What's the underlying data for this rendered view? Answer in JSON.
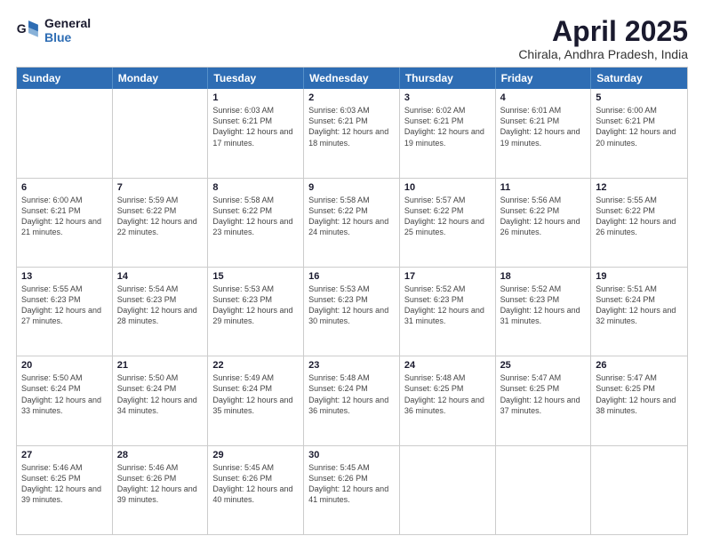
{
  "logo": {
    "line1": "General",
    "line2": "Blue"
  },
  "title": "April 2025",
  "subtitle": "Chirala, Andhra Pradesh, India",
  "days": [
    "Sunday",
    "Monday",
    "Tuesday",
    "Wednesday",
    "Thursday",
    "Friday",
    "Saturday"
  ],
  "weeks": [
    [
      {
        "day": "",
        "info": ""
      },
      {
        "day": "",
        "info": ""
      },
      {
        "day": "1",
        "info": "Sunrise: 6:03 AM\nSunset: 6:21 PM\nDaylight: 12 hours and 17 minutes."
      },
      {
        "day": "2",
        "info": "Sunrise: 6:03 AM\nSunset: 6:21 PM\nDaylight: 12 hours and 18 minutes."
      },
      {
        "day": "3",
        "info": "Sunrise: 6:02 AM\nSunset: 6:21 PM\nDaylight: 12 hours and 19 minutes."
      },
      {
        "day": "4",
        "info": "Sunrise: 6:01 AM\nSunset: 6:21 PM\nDaylight: 12 hours and 19 minutes."
      },
      {
        "day": "5",
        "info": "Sunrise: 6:00 AM\nSunset: 6:21 PM\nDaylight: 12 hours and 20 minutes."
      }
    ],
    [
      {
        "day": "6",
        "info": "Sunrise: 6:00 AM\nSunset: 6:21 PM\nDaylight: 12 hours and 21 minutes."
      },
      {
        "day": "7",
        "info": "Sunrise: 5:59 AM\nSunset: 6:22 PM\nDaylight: 12 hours and 22 minutes."
      },
      {
        "day": "8",
        "info": "Sunrise: 5:58 AM\nSunset: 6:22 PM\nDaylight: 12 hours and 23 minutes."
      },
      {
        "day": "9",
        "info": "Sunrise: 5:58 AM\nSunset: 6:22 PM\nDaylight: 12 hours and 24 minutes."
      },
      {
        "day": "10",
        "info": "Sunrise: 5:57 AM\nSunset: 6:22 PM\nDaylight: 12 hours and 25 minutes."
      },
      {
        "day": "11",
        "info": "Sunrise: 5:56 AM\nSunset: 6:22 PM\nDaylight: 12 hours and 26 minutes."
      },
      {
        "day": "12",
        "info": "Sunrise: 5:55 AM\nSunset: 6:22 PM\nDaylight: 12 hours and 26 minutes."
      }
    ],
    [
      {
        "day": "13",
        "info": "Sunrise: 5:55 AM\nSunset: 6:23 PM\nDaylight: 12 hours and 27 minutes."
      },
      {
        "day": "14",
        "info": "Sunrise: 5:54 AM\nSunset: 6:23 PM\nDaylight: 12 hours and 28 minutes."
      },
      {
        "day": "15",
        "info": "Sunrise: 5:53 AM\nSunset: 6:23 PM\nDaylight: 12 hours and 29 minutes."
      },
      {
        "day": "16",
        "info": "Sunrise: 5:53 AM\nSunset: 6:23 PM\nDaylight: 12 hours and 30 minutes."
      },
      {
        "day": "17",
        "info": "Sunrise: 5:52 AM\nSunset: 6:23 PM\nDaylight: 12 hours and 31 minutes."
      },
      {
        "day": "18",
        "info": "Sunrise: 5:52 AM\nSunset: 6:23 PM\nDaylight: 12 hours and 31 minutes."
      },
      {
        "day": "19",
        "info": "Sunrise: 5:51 AM\nSunset: 6:24 PM\nDaylight: 12 hours and 32 minutes."
      }
    ],
    [
      {
        "day": "20",
        "info": "Sunrise: 5:50 AM\nSunset: 6:24 PM\nDaylight: 12 hours and 33 minutes."
      },
      {
        "day": "21",
        "info": "Sunrise: 5:50 AM\nSunset: 6:24 PM\nDaylight: 12 hours and 34 minutes."
      },
      {
        "day": "22",
        "info": "Sunrise: 5:49 AM\nSunset: 6:24 PM\nDaylight: 12 hours and 35 minutes."
      },
      {
        "day": "23",
        "info": "Sunrise: 5:48 AM\nSunset: 6:24 PM\nDaylight: 12 hours and 36 minutes."
      },
      {
        "day": "24",
        "info": "Sunrise: 5:48 AM\nSunset: 6:25 PM\nDaylight: 12 hours and 36 minutes."
      },
      {
        "day": "25",
        "info": "Sunrise: 5:47 AM\nSunset: 6:25 PM\nDaylight: 12 hours and 37 minutes."
      },
      {
        "day": "26",
        "info": "Sunrise: 5:47 AM\nSunset: 6:25 PM\nDaylight: 12 hours and 38 minutes."
      }
    ],
    [
      {
        "day": "27",
        "info": "Sunrise: 5:46 AM\nSunset: 6:25 PM\nDaylight: 12 hours and 39 minutes."
      },
      {
        "day": "28",
        "info": "Sunrise: 5:46 AM\nSunset: 6:26 PM\nDaylight: 12 hours and 39 minutes."
      },
      {
        "day": "29",
        "info": "Sunrise: 5:45 AM\nSunset: 6:26 PM\nDaylight: 12 hours and 40 minutes."
      },
      {
        "day": "30",
        "info": "Sunrise: 5:45 AM\nSunset: 6:26 PM\nDaylight: 12 hours and 41 minutes."
      },
      {
        "day": "",
        "info": ""
      },
      {
        "day": "",
        "info": ""
      },
      {
        "day": "",
        "info": ""
      }
    ]
  ]
}
